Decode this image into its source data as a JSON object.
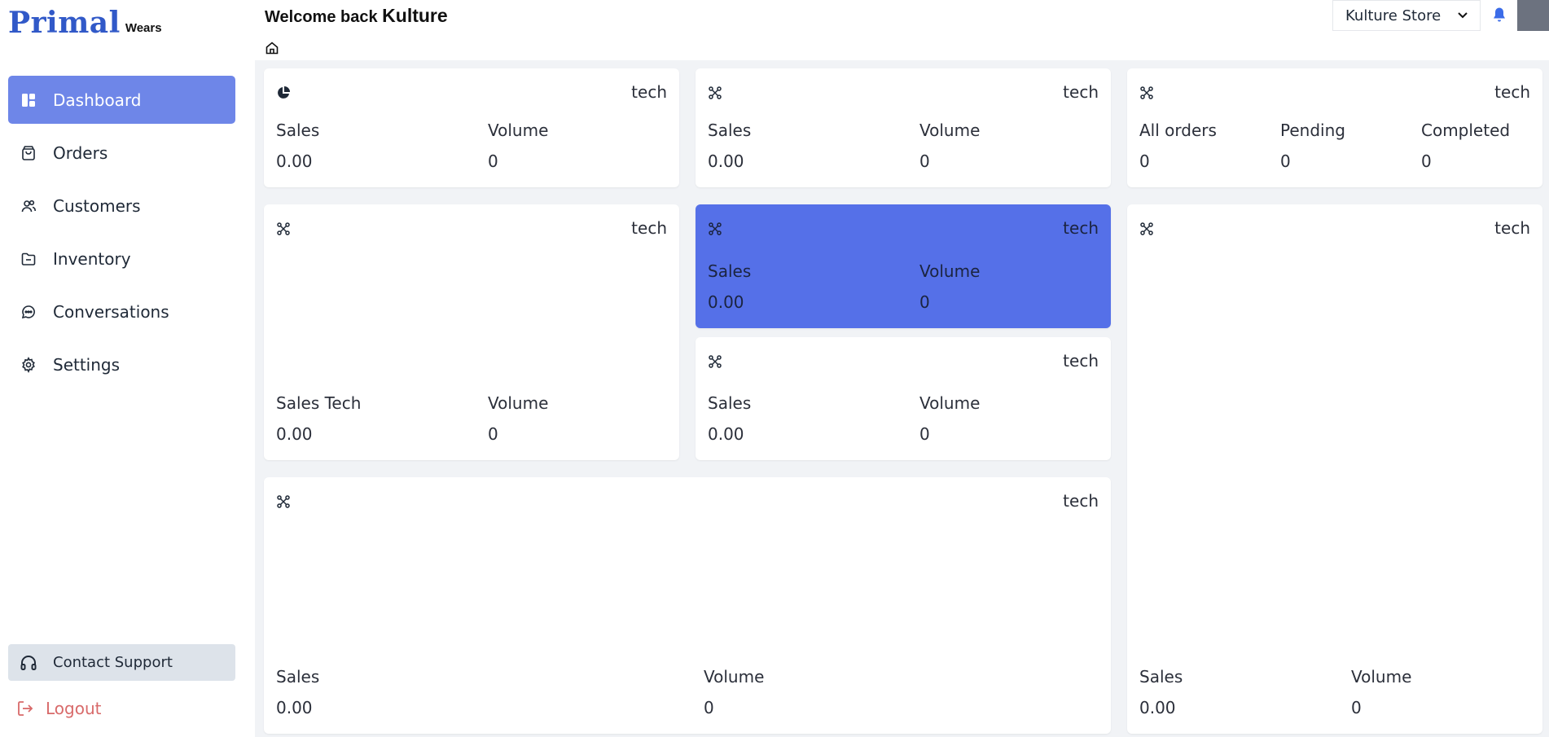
{
  "brand": {
    "name": "Primal",
    "sub": "Wears"
  },
  "sidebar": {
    "items": [
      {
        "label": "Dashboard",
        "icon": "dashboard-icon",
        "active": true
      },
      {
        "label": "Orders",
        "icon": "bag-icon"
      },
      {
        "label": "Customers",
        "icon": "users-icon"
      },
      {
        "label": "Inventory",
        "icon": "folder-icon"
      },
      {
        "label": "Conversations",
        "icon": "chat-icon"
      },
      {
        "label": "Settings",
        "icon": "gear-icon"
      }
    ],
    "support_label": "Contact Support",
    "logout_label": "Logout"
  },
  "header": {
    "welcome_prefix": "Welcome back",
    "user_name": "Kulture",
    "store": "Kulture Store"
  },
  "colors": {
    "accent": "#6e86e8",
    "card_highlight": "#5570e8",
    "brand": "#3159c8",
    "logout": "#d86a6a"
  },
  "cards": {
    "c1": {
      "tag": "tech",
      "icon": "pie-chart-icon",
      "m1_label": "Sales",
      "m1_value": "0.00",
      "m2_label": "Volume",
      "m2_value": "0"
    },
    "c2": {
      "tag": "tech",
      "icon": "command-icon",
      "m1_label": "Sales",
      "m1_value": "0.00",
      "m2_label": "Volume",
      "m2_value": "0"
    },
    "c3": {
      "tag": "tech",
      "icon": "command-icon",
      "m1_label": "All orders",
      "m1_value": "0",
      "m2_label": "Pending",
      "m2_value": "0",
      "m3_label": "Completed",
      "m3_value": "0"
    },
    "c4": {
      "tag": "tech",
      "icon": "command-icon",
      "m1_label": "Sales Tech",
      "m1_value": "0.00",
      "m2_label": "Volume",
      "m2_value": "0"
    },
    "c5": {
      "tag": "tech",
      "icon": "command-icon",
      "m1_label": "Sales",
      "m1_value": "0.00",
      "m2_label": "Volume",
      "m2_value": "0"
    },
    "c6": {
      "tag": "tech",
      "icon": "command-icon",
      "m1_label": "Sales",
      "m1_value": "0.00",
      "m2_label": "Volume",
      "m2_value": "0"
    },
    "c7": {
      "tag": "tech",
      "icon": "command-icon",
      "m1_label": "Sales",
      "m1_value": "0.00",
      "m2_label": "Volume",
      "m2_value": "0"
    },
    "c8": {
      "tag": "tech",
      "icon": "command-icon",
      "m1_label": "Sales",
      "m1_value": "0.00",
      "m2_label": "Volume",
      "m2_value": "0"
    }
  }
}
